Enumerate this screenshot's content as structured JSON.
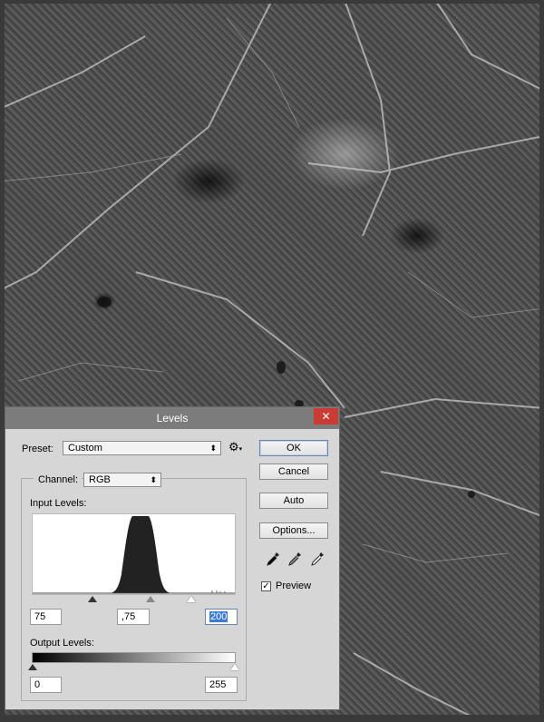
{
  "dialog": {
    "title": "Levels",
    "close_glyph": "✕",
    "preset": {
      "label": "Preset:",
      "value": "Custom",
      "options_icon": "gear-icon"
    },
    "channel": {
      "label": "Channel:",
      "value": "RGB"
    },
    "input_levels": {
      "label": "Input Levels:",
      "black": "75",
      "gamma": ",75",
      "white": "200"
    },
    "output_levels": {
      "label": "Output Levels:",
      "black": "0",
      "white": "255"
    },
    "buttons": {
      "ok": "OK",
      "cancel": "Cancel",
      "auto": "Auto",
      "options": "Options..."
    },
    "eyedroppers": [
      "black-eyedropper-icon",
      "gray-eyedropper-icon",
      "white-eyedropper-icon"
    ],
    "preview": {
      "label": "Preview",
      "checked": true,
      "check_glyph": "✓"
    }
  },
  "colors": {
    "titlebar": "#7c7c7c",
    "close": "#c93b33",
    "dialog_bg": "#d6d6d6",
    "selection": "#3d7bd8"
  }
}
